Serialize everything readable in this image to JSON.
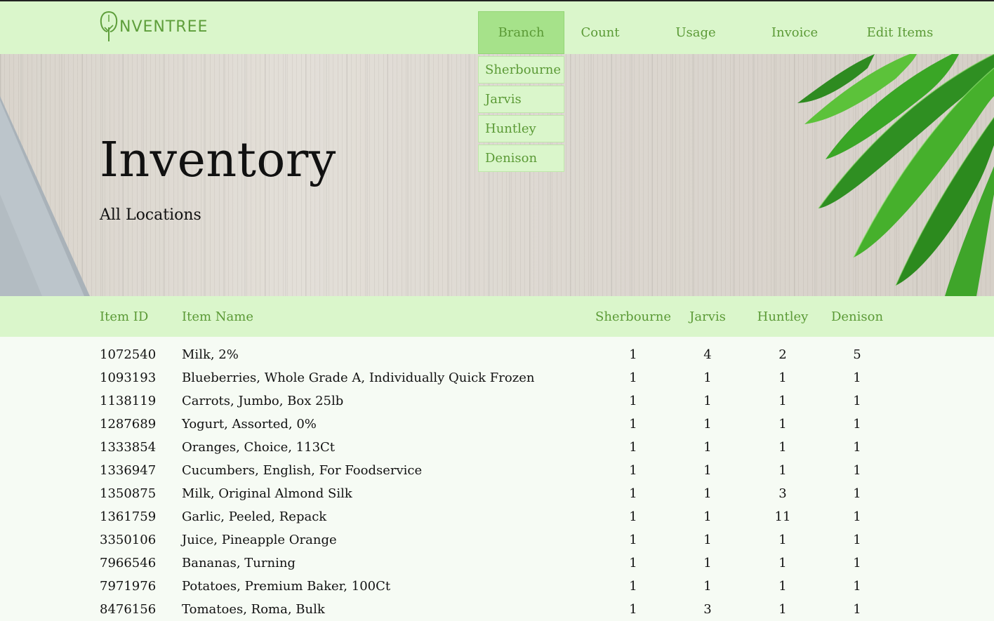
{
  "brand": {
    "logo_text": "NVENTREE"
  },
  "nav": {
    "items": [
      {
        "label": "Branch"
      },
      {
        "label": "Count"
      },
      {
        "label": "Usage"
      },
      {
        "label": "Invoice"
      },
      {
        "label": "Edit Items"
      }
    ],
    "branch_dropdown": [
      "Sherbourne",
      "Jarvis",
      "Huntley",
      "Denison"
    ]
  },
  "hero": {
    "title": "Inventory",
    "subtitle": "All Locations"
  },
  "table": {
    "columns": [
      "Item ID",
      "Item Name",
      "Sherbourne",
      "Jarvis",
      "Huntley",
      "Denison"
    ],
    "rows": [
      [
        "1072540",
        "Milk, 2%",
        "1",
        "4",
        "2",
        "5"
      ],
      [
        "1093193",
        "Blueberries, Whole Grade A, Individually Quick Frozen",
        "1",
        "1",
        "1",
        "1"
      ],
      [
        "1138119",
        "Carrots, Jumbo, Box 25lb",
        "1",
        "1",
        "1",
        "1"
      ],
      [
        "1287689",
        "Yogurt, Assorted, 0%",
        "1",
        "1",
        "1",
        "1"
      ],
      [
        "1333854",
        "Oranges, Choice, 113Ct",
        "1",
        "1",
        "1",
        "1"
      ],
      [
        "1336947",
        "Cucumbers, English, For Foodservice",
        "1",
        "1",
        "1",
        "1"
      ],
      [
        "1350875",
        "Milk, Original Almond Silk",
        "1",
        "1",
        "3",
        "1"
      ],
      [
        "1361759",
        "Garlic, Peeled, Repack",
        "1",
        "1",
        "11",
        "1"
      ],
      [
        "3350106",
        "Juice, Pineapple Orange",
        "1",
        "1",
        "1",
        "1"
      ],
      [
        "7966546",
        "Bananas, Turning",
        "1",
        "1",
        "1",
        "1"
      ],
      [
        "7971976",
        "Potatoes, Premium Baker, 100Ct",
        "1",
        "1",
        "1",
        "1"
      ],
      [
        "8476156",
        "Tomatoes, Roma, Bulk",
        "1",
        "3",
        "1",
        "1"
      ]
    ]
  },
  "colors": {
    "header_bg": "#daf6cb",
    "nav_active_bg": "#a6e28a",
    "accent_green": "#5b9a36",
    "page_bg": "#f6fbf4"
  }
}
